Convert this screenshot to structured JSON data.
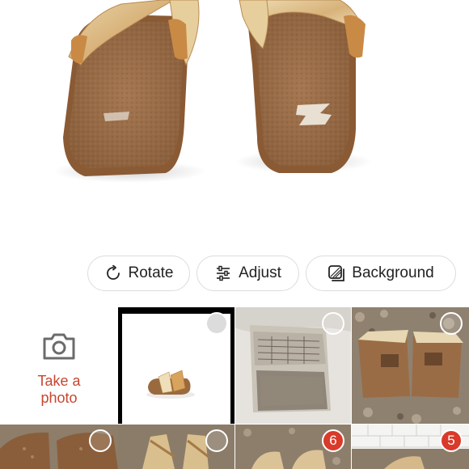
{
  "tools": {
    "rotate_label": "Rotate",
    "adjust_label": "Adjust",
    "background_label": "Background"
  },
  "camera": {
    "label_line1": "Take a",
    "label_line2": "photo"
  },
  "badges": {
    "tile6": "6",
    "tile7": "5"
  },
  "colors": {
    "accent": "#c8452f",
    "badge": "#d93a2a",
    "border": "#dcdcdc"
  }
}
